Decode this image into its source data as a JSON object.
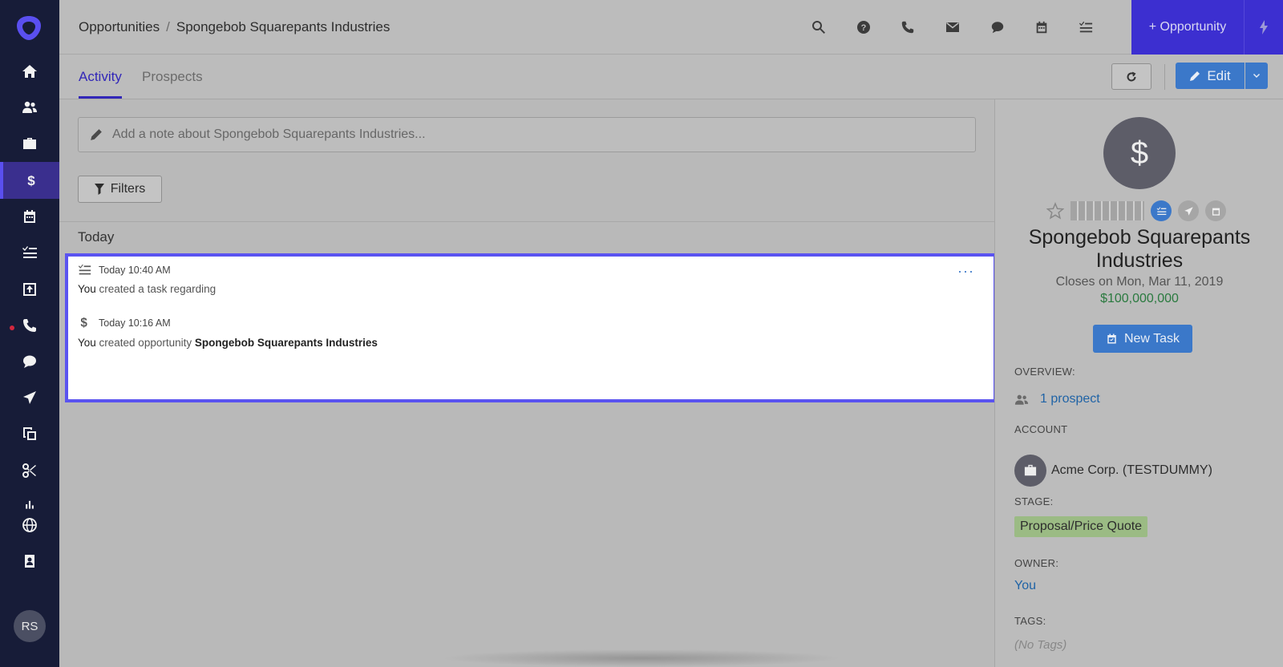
{
  "nav": {
    "items": [
      {
        "name": "home",
        "icon": "home-icon"
      },
      {
        "name": "people",
        "icon": "people-icon"
      },
      {
        "name": "accounts",
        "icon": "briefcase-icon"
      },
      {
        "name": "opportunities",
        "icon": "dollar-icon",
        "active": true
      },
      {
        "name": "calendar",
        "icon": "calendar-icon"
      },
      {
        "name": "tasks",
        "icon": "task-list-icon"
      },
      {
        "name": "import",
        "icon": "upload-icon"
      },
      {
        "name": "calls",
        "icon": "phone-icon",
        "notification": true
      },
      {
        "name": "chat",
        "icon": "chat-icon"
      },
      {
        "name": "sequences",
        "icon": "send-icon"
      },
      {
        "name": "templates",
        "icon": "copy-icon"
      },
      {
        "name": "snippets",
        "icon": "scissors-icon"
      },
      {
        "name": "reports",
        "icon": "bar-chart-icon"
      },
      {
        "name": "web",
        "icon": "globe-icon"
      },
      {
        "name": "contacts",
        "icon": "contact-card-icon"
      }
    ],
    "avatar_initials": "RS"
  },
  "topbar": {
    "breadcrumb_parent": "Opportunities",
    "breadcrumb_separator": "/",
    "breadcrumb_current": "Spongebob Squarepants Industries",
    "icons": [
      "search-icon",
      "help-icon",
      "phone-icon",
      "mail-icon",
      "chat-icon",
      "calendar-icon",
      "task-list-icon"
    ],
    "add_opportunity_label": "+ Opportunity"
  },
  "tabs": [
    {
      "label": "Activity",
      "active": true
    },
    {
      "label": "Prospects",
      "active": false
    }
  ],
  "toolbar": {
    "edit_label": "Edit"
  },
  "feed": {
    "note_placeholder": "Add a note about Spongebob Squarepants Industries...",
    "filters_label": "Filters",
    "day_label": "Today",
    "activities": [
      {
        "icon": "task-list-icon",
        "time": "Today 10:40 AM",
        "actor": "You",
        "text": " created a task regarding",
        "object": ""
      },
      {
        "icon": "dollar-icon",
        "time": "Today 10:16 AM",
        "actor": "You",
        "text": " created opportunity ",
        "object": "Spongebob Squarepants Industries"
      }
    ],
    "more_label": "···"
  },
  "panel": {
    "avatar_symbol": "$",
    "name": "Spongebob Squarepants Industries",
    "closes": "Closes on Mon, Mar 11, 2019",
    "amount": "$100,000,000",
    "new_task_label": "New Task",
    "overview_label": "OVERVIEW:",
    "prospect_count": "1 prospect",
    "account_label": "ACCOUNT",
    "account_name": "Acme Corp. (TESTDUMMY)",
    "stage_label": "STAGE:",
    "stage_value": "Proposal/Price Quote",
    "owner_label": "OWNER:",
    "owner_value": "You",
    "tags_label": "TAGS:",
    "tags_value": "(No Tags)"
  },
  "colors": {
    "nav_bg": "#171c38",
    "accent": "#3c2fd0",
    "button_blue": "#3b78c9",
    "highlight_border": "#5a53f0",
    "amount_green": "#2a7a3f",
    "stage_green": "#9bbb84"
  }
}
